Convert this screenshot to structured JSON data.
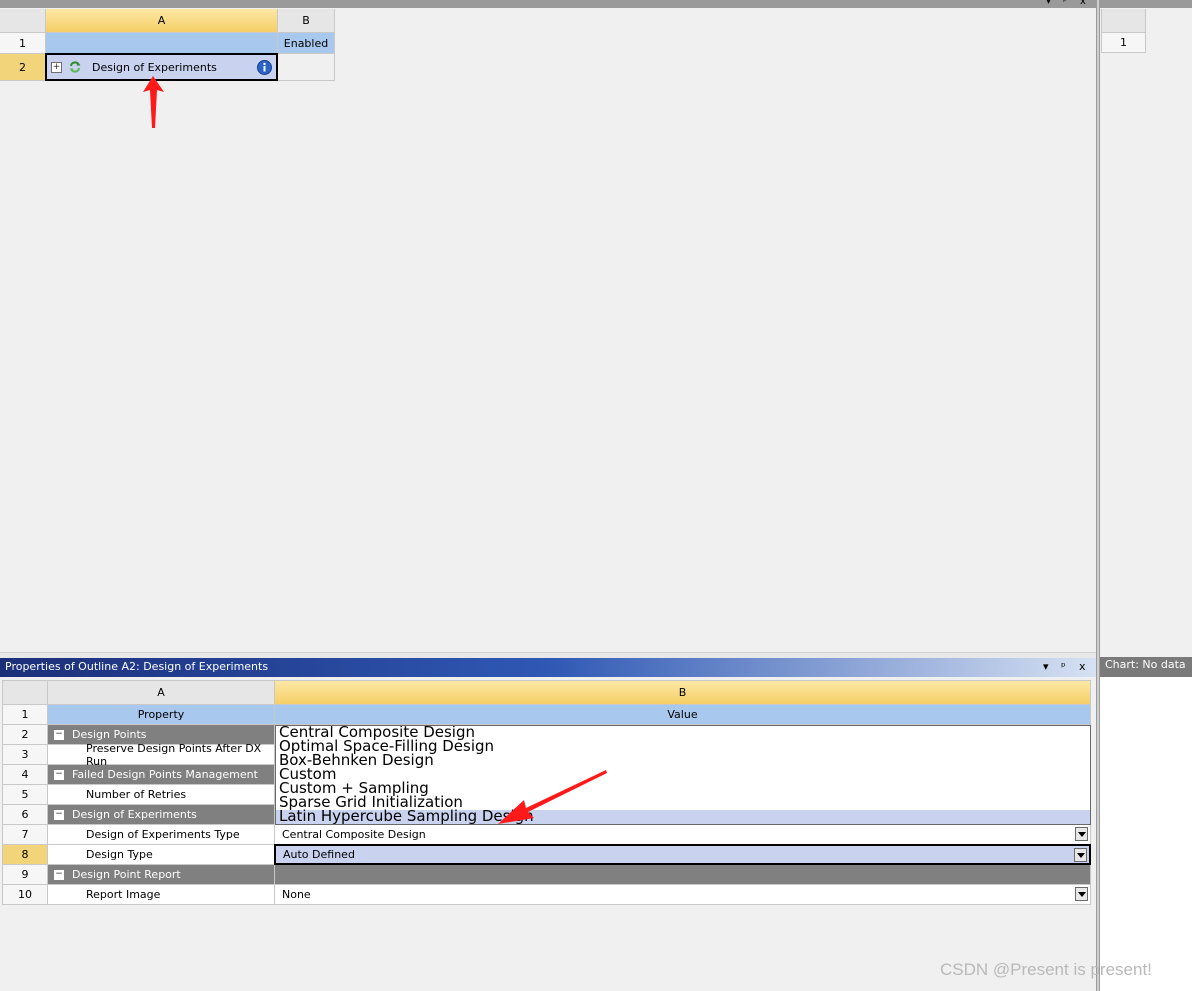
{
  "outline": {
    "col_a": "A",
    "col_b": "B",
    "rows": [
      {
        "num": "1",
        "a": "",
        "b": "Enabled"
      },
      {
        "num": "2",
        "a": "Design of Experiments",
        "b": ""
      }
    ],
    "window_controls": [
      "▾",
      "ᵖ",
      "x"
    ]
  },
  "side_table": {
    "row_num": "1"
  },
  "properties": {
    "title": "Properties of Outline A2: Design of Experiments",
    "window_controls": [
      "▾",
      "ᵖ",
      "x"
    ],
    "col_a": "A",
    "col_b": "B",
    "header_row": {
      "num": "1",
      "a": "Property",
      "b": "Value"
    },
    "rows": [
      {
        "num": "2",
        "type": "section",
        "label": "Design Points",
        "value": ""
      },
      {
        "num": "3",
        "type": "prop",
        "label": "Preserve Design Points After DX Run",
        "value": ""
      },
      {
        "num": "4",
        "type": "section",
        "label": "Failed Design Points Management",
        "value": ""
      },
      {
        "num": "5",
        "type": "prop",
        "label": "Number of Retries",
        "value": ""
      },
      {
        "num": "6",
        "type": "section",
        "label": "Design of Experiments",
        "value": ""
      },
      {
        "num": "7",
        "type": "prop",
        "label": "Design of Experiments Type",
        "value": "Central Composite Design"
      },
      {
        "num": "8",
        "type": "prop",
        "label": "Design Type",
        "value": "Auto Defined"
      },
      {
        "num": "9",
        "type": "section",
        "label": "Design Point Report",
        "value": ""
      },
      {
        "num": "10",
        "type": "prop",
        "label": "Report Image",
        "value": "None"
      }
    ],
    "dropdown_options": [
      "Central Composite Design",
      "Optimal Space-Filling Design",
      "Box-Behnken Design",
      "Custom",
      "Custom + Sampling",
      "Sparse Grid Initialization",
      "Latin Hypercube Sampling Design"
    ],
    "dropdown_highlighted": "Latin Hypercube Sampling Design"
  },
  "chart_panel": {
    "label": "Chart: No data"
  },
  "watermark": "CSDN @Present is present!",
  "colors": {
    "selected_header": "#f5cf66",
    "selection_fill": "#c9d3ef",
    "section_gray": "#808080",
    "annotation_arrow": "#ff1a1a"
  }
}
